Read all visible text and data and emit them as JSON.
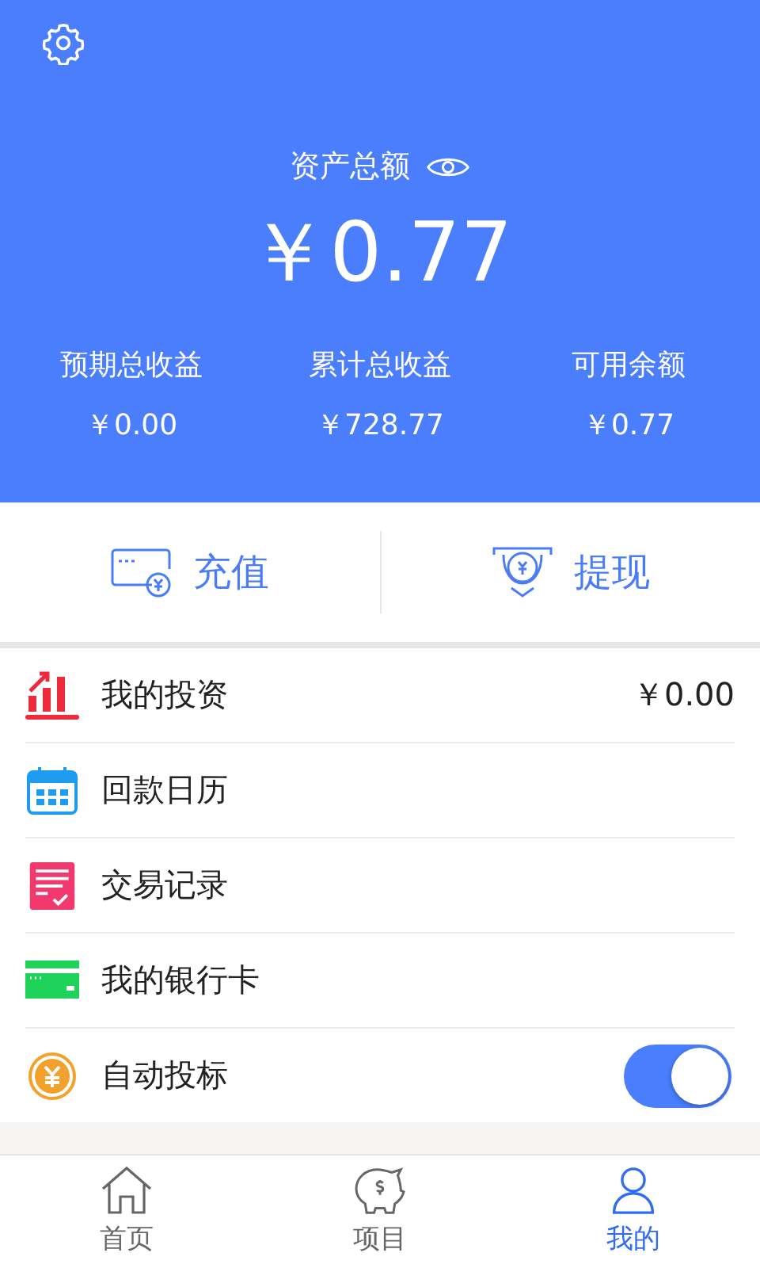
{
  "header": {
    "title": "资产总额",
    "total": "￥0.77",
    "stats": [
      {
        "label": "预期总收益",
        "value": "￥0.00"
      },
      {
        "label": "累计总收益",
        "value": "￥728.77"
      },
      {
        "label": "可用余额",
        "value": "￥0.77"
      }
    ]
  },
  "actions": [
    {
      "label": "充值"
    },
    {
      "label": "提现"
    }
  ],
  "menu": [
    {
      "kind": "value",
      "label": "我的投资",
      "value": "￥0.00"
    },
    {
      "kind": "plain",
      "label": "回款日历"
    },
    {
      "kind": "plain",
      "label": "交易记录"
    },
    {
      "kind": "plain",
      "label": "我的银行卡"
    },
    {
      "kind": "toggle",
      "label": "自动投标",
      "on": true
    }
  ],
  "tabs": [
    {
      "label": "首页",
      "selected": false
    },
    {
      "label": "项目",
      "selected": false
    },
    {
      "label": "我的",
      "selected": true
    }
  ]
}
